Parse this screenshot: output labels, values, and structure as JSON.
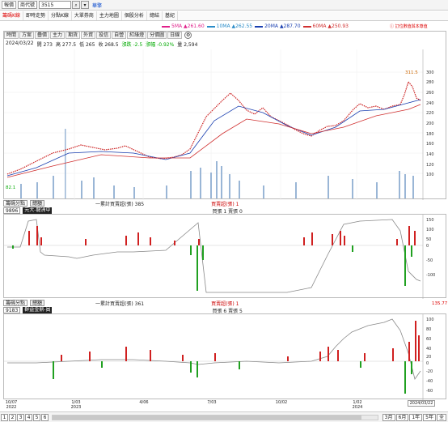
{
  "topbar": {
    "tab_label": "報價",
    "name_label": "商代號",
    "code": "3515",
    "search_icon_glyph": "⌕",
    "dropdown_glyph": "▾",
    "stock_name": "華擎"
  },
  "menu": [
    "籌碼K線",
    "即時走勢",
    "分點K線",
    "大單券商",
    "主力地圖",
    "個股分析",
    "總結",
    "基紀"
  ],
  "price_panel": {
    "tools": [
      "時間",
      "方案",
      "疊價",
      "主力",
      "期貨",
      "外資",
      "投信",
      "自營",
      "紅綠燈",
      "分價圖",
      "日線"
    ],
    "date": "2024/03/22",
    "open": "開 273",
    "high": "高 277.5",
    "low": "低 265",
    "close": "收 268.5",
    "change": "漲跌 -2.5",
    "pct": "漲幅 -0.92%",
    "vol": "量 2,594",
    "ma": [
      {
        "label": "5MA",
        "value": "▲261.60",
        "color": "#e0208a"
      },
      {
        "label": "10MA",
        "value": "▲262.55",
        "color": "#2a8cc8"
      },
      {
        "label": "20MA",
        "value": "▲287.70",
        "color": "#1a3fb0"
      },
      {
        "label": "60MA",
        "value": "▲250.93",
        "color": "#d03030"
      }
    ],
    "note": "ⓘ 訂位數值與本尊值",
    "yticks": [
      "300",
      "280",
      "260",
      "240",
      "220",
      "200",
      "180",
      "160",
      "140",
      "120",
      "100"
    ],
    "high_label": "311.5",
    "low_label": "82.1"
  },
  "panel2": {
    "tab": "籌碼分點",
    "code": "9896",
    "code_suffix": "元大-龍洲中",
    "button": "總額",
    "legend1": "一累計買賣超(張) 385",
    "legend2": "買賣超(張) 1",
    "legend3": "買張 1 賣張 0",
    "yticks": [
      "150",
      "100",
      "50",
      "0",
      "-50",
      "-100"
    ]
  },
  "panel3": {
    "tab": "籌碼分點",
    "code": "9183",
    "code_suffix": "群益金鼎-員",
    "button": "總額",
    "legend1": "一累計買賣超(張) 361",
    "legend2": "買賣超(張) 1",
    "legend3": "買張 6 賣張 5",
    "current": "135.77",
    "yticks": [
      "100",
      "80",
      "60",
      "40",
      "20",
      "0",
      "-20",
      "-40",
      "-60"
    ]
  },
  "xaxis": [
    {
      "top": "10/07",
      "bottom": "2022"
    },
    {
      "top": "1/03",
      "bottom": "2023"
    },
    {
      "top": "4/06",
      "bottom": ""
    },
    {
      "top": "7/03",
      "bottom": ""
    },
    {
      "top": "10/02",
      "bottom": ""
    },
    {
      "top": "1/02",
      "bottom": "2024"
    },
    {
      "top": "2024/03/22",
      "bottom": ""
    }
  ],
  "bottom": {
    "pages": [
      "1",
      "2",
      "3",
      "4",
      "5",
      "6"
    ],
    "periods": [
      "3月",
      "6月",
      "1年",
      "5年",
      "全"
    ]
  }
}
